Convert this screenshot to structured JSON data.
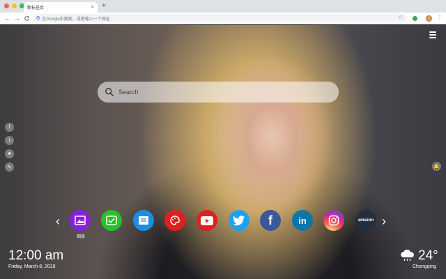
{
  "browser": {
    "tab_title": "新标签页",
    "tab_close": "×",
    "new_tab": "+",
    "omnibox_text": "在Google中搜索，或者输入一个网址",
    "star": "☆",
    "menu": "⋮",
    "back": "←",
    "forward": "→",
    "reload": "C"
  },
  "search": {
    "placeholder": "Search"
  },
  "social_left": [
    "f",
    "t",
    "♣",
    "✎"
  ],
  "shortcuts": {
    "first_label": "图库",
    "items": [
      {
        "name": "gallery",
        "color": "#8a1de0"
      },
      {
        "name": "check",
        "color": "#2ac02a"
      },
      {
        "name": "notes",
        "color": "#1a8fe0"
      },
      {
        "name": "paint",
        "color": "#e02020"
      },
      {
        "name": "youtube",
        "color": "#e02020"
      },
      {
        "name": "twitter",
        "color": "#1da1f2"
      },
      {
        "name": "facebook",
        "color": "#3b5998"
      },
      {
        "name": "linkedin",
        "color": "#0e76a8"
      },
      {
        "name": "instagram",
        "color": "#d6307c"
      },
      {
        "name": "amazon",
        "color": "#232f3e"
      }
    ],
    "facebook_glyph": "f",
    "linkedin_glyph": "in",
    "amazon_text": "amazon",
    "prev": "‹",
    "next": "›"
  },
  "clock": {
    "time": "12:00 am",
    "date": "Friday, March 8, 2019"
  },
  "weather": {
    "temp": "24°",
    "city": "Chongqing"
  }
}
